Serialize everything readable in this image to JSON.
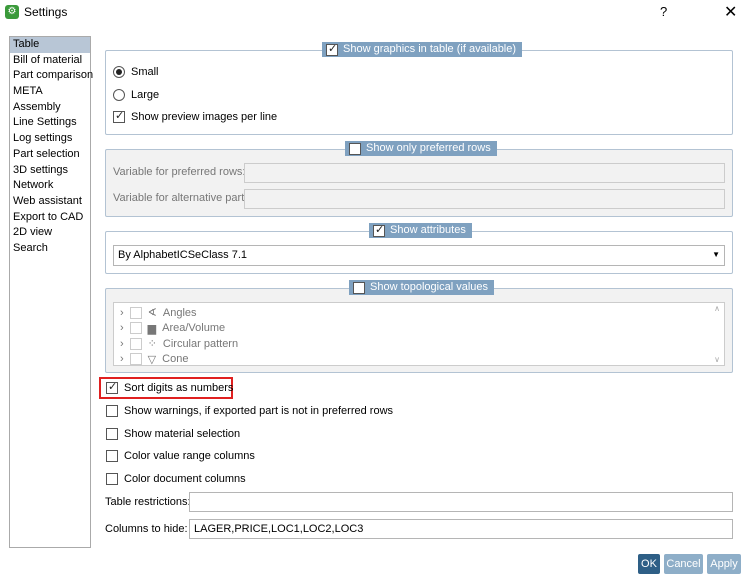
{
  "window": {
    "title": "Settings",
    "help": "?",
    "close": "✕"
  },
  "sidebar": {
    "items": [
      "Table",
      "Bill of material",
      "Part comparison",
      "META",
      "Assembly",
      "Line Settings",
      "Log settings",
      "Part selection",
      "3D settings",
      "Network",
      "Web assistant",
      "Export to CAD",
      "2D view",
      "Search"
    ]
  },
  "graphics": {
    "legend": "Show graphics in table (if available)",
    "small": "Small",
    "large": "Large",
    "preview": "Show preview images per line"
  },
  "preferred": {
    "legend": "Show only preferred rows",
    "var_pref": "Variable for preferred rows:",
    "var_alt": "Variable for alternative part:"
  },
  "attributes": {
    "legend": "Show attributes",
    "selected": "By AlphabetICSeClass 7.1"
  },
  "topological": {
    "legend": "Show topological values",
    "items": [
      "Angles",
      "Area/Volume",
      "Circular pattern",
      "Cone"
    ]
  },
  "options": {
    "sort_digits": "Sort digits as numbers",
    "warnings": "Show warnings, if exported part is not in preferred rows",
    "material": "Show material selection",
    "color_range": "Color value range columns",
    "color_doc": "Color document columns"
  },
  "fields": {
    "table_restrictions_label": "Table restrictions:",
    "table_restrictions_value": "",
    "columns_hide_label": "Columns to hide:",
    "columns_hide_value": "LAGER,PRICE,LOC1,LOC2,LOC3"
  },
  "buttons": {
    "ok": "OK",
    "cancel": "Cancel",
    "apply": "Apply"
  }
}
